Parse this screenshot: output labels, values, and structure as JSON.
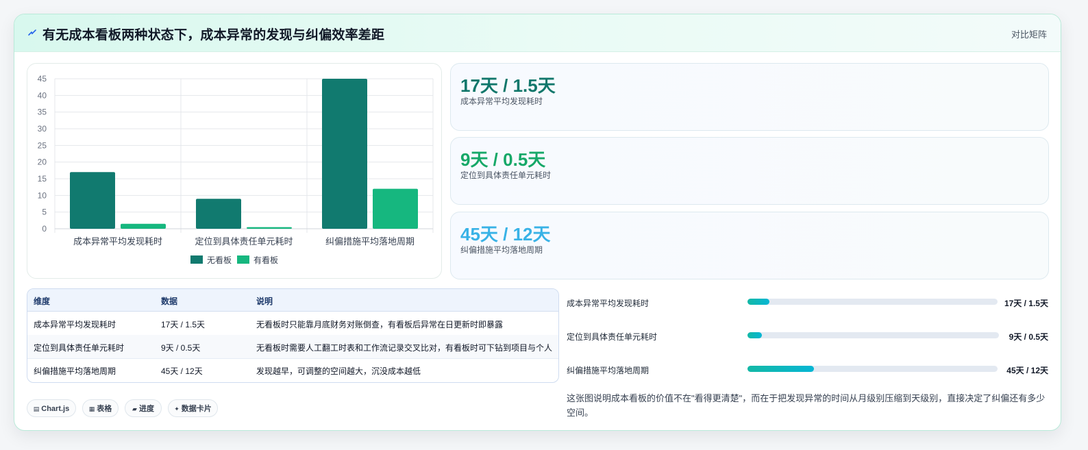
{
  "header": {
    "title": "有无成本看板两种状态下，成本异常的发现与纠偏效率差距",
    "tag": "对比矩阵"
  },
  "colors": {
    "no_board": "#117a6f",
    "with_board": "#16b77f",
    "kpi1": "#11776b",
    "kpi2": "#16a868",
    "kpi3": "#38b2e6",
    "progress": "#14b8a6"
  },
  "chart_data": {
    "type": "bar",
    "categories": [
      "成本异常平均发现耗时",
      "定位到具体责任单元耗时",
      "纠偏措施平均落地周期"
    ],
    "series": [
      {
        "name": "无看板",
        "values": [
          17,
          9,
          45
        ]
      },
      {
        "name": "有看板",
        "values": [
          1.5,
          0.5,
          12
        ]
      }
    ],
    "ylim": [
      0,
      45
    ],
    "yticks": [
      0,
      5,
      10,
      15,
      20,
      25,
      30,
      35,
      40,
      45
    ],
    "grid": true,
    "legend": "bottom"
  },
  "kpis": [
    {
      "value": "17天 / 1.5天",
      "label": "成本异常平均发现耗时"
    },
    {
      "value": "9天 / 0.5天",
      "label": "定位到具体责任单元耗时"
    },
    {
      "value": "45天 / 12天",
      "label": "纠偏措施平均落地周期"
    }
  ],
  "table": {
    "headers": [
      "维度",
      "数据",
      "说明"
    ],
    "rows": [
      [
        "成本异常平均发现耗时",
        "17天 / 1.5天",
        "无看板时只能靠月底财务对账倒查，有看板后异常在日更新时即暴露"
      ],
      [
        "定位到具体责任单元耗时",
        "9天 / 0.5天",
        "无看板时需要人工翻工时表和工作流记录交叉比对，有看板时可下钻到项目与个人"
      ],
      [
        "纠偏措施平均落地周期",
        "45天 / 12天",
        "发现越早，可调整的空间越大，沉没成本越低"
      ]
    ]
  },
  "chips": [
    {
      "icon": "▤",
      "label": "Chart.js"
    },
    {
      "icon": "▦",
      "label": "表格"
    },
    {
      "icon": "▰",
      "label": "进度"
    },
    {
      "icon": "✦",
      "label": "数据卡片"
    }
  ],
  "progress": [
    {
      "label": "成本异常平均发现耗时",
      "value": "17天 / 1.5天",
      "ratio": 0.088
    },
    {
      "label": "定位到具体责任单元耗时",
      "value": "9天 / 0.5天",
      "ratio": 0.056
    },
    {
      "label": "纠偏措施平均落地周期",
      "value": "45天 / 12天",
      "ratio": 0.267
    }
  ],
  "summary": "这张图说明成本看板的价值不在\"看得更清楚\"，而在于把发现异常的时间从月级别压缩到天级别，直接决定了纠偏还有多少空间。"
}
